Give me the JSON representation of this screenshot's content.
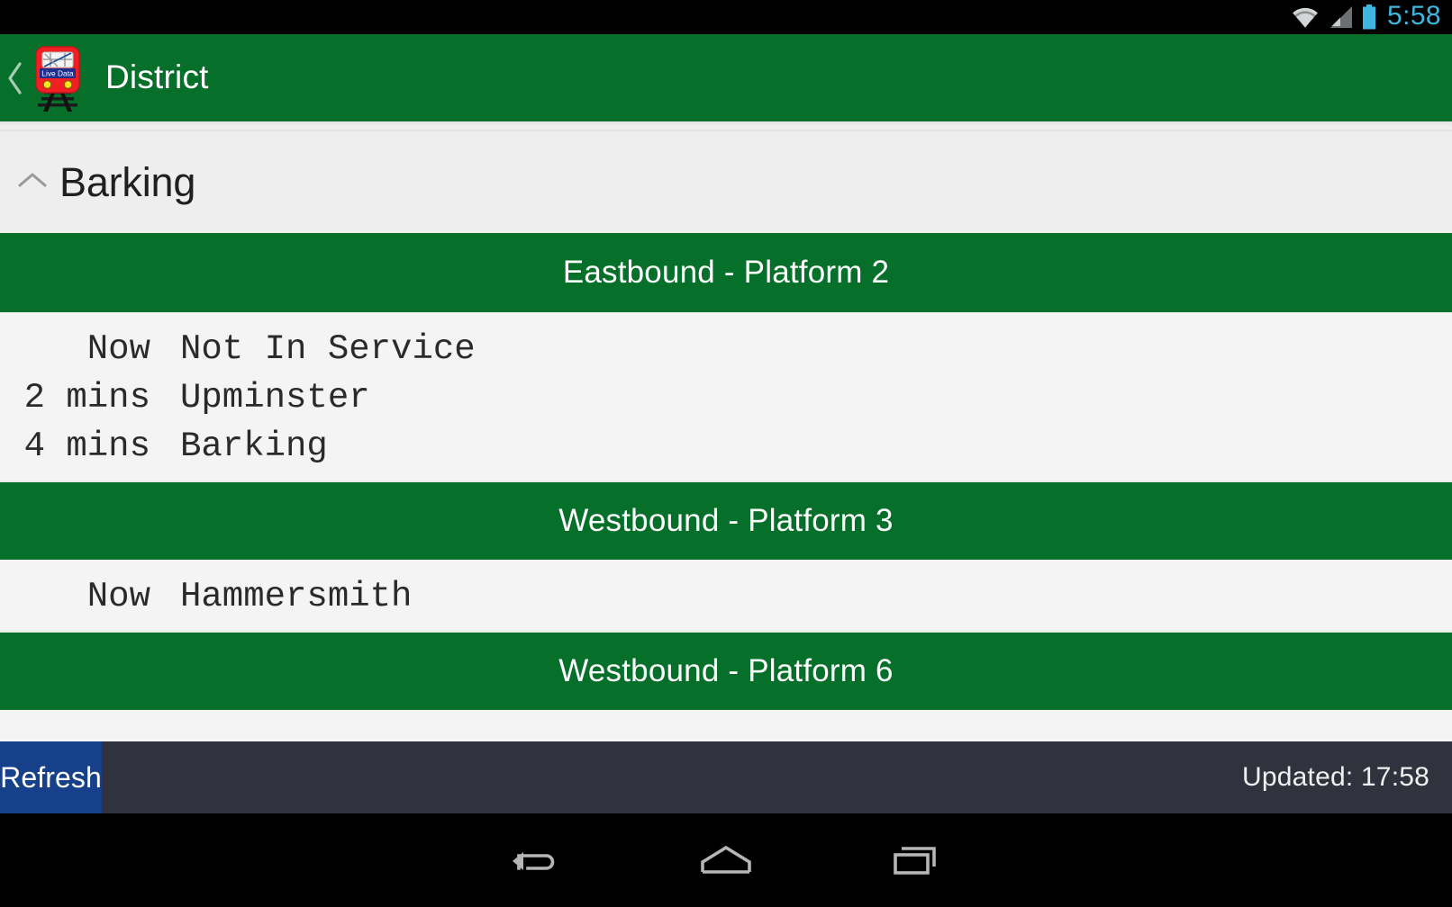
{
  "status_bar": {
    "time": "5:58",
    "icons": [
      "wifi-icon",
      "cellular-signal-icon",
      "battery-icon"
    ],
    "accent_color": "#3fb6e0"
  },
  "action_bar": {
    "back_label": "back-chevron",
    "app_icon_label": "Live Data",
    "title": "District",
    "background_color": "#06702a",
    "text_color": "#ffffff"
  },
  "station": {
    "name": "Barking",
    "expanded": true,
    "toggle_icon": "chevron-up-icon"
  },
  "sections": [
    {
      "heading": "Eastbound - Platform 2",
      "departures": [
        {
          "time": "Now",
          "destination": "Not In Service"
        },
        {
          "time": "2 mins",
          "destination": "Upminster"
        },
        {
          "time": "4 mins",
          "destination": "Barking"
        }
      ]
    },
    {
      "heading": "Westbound - Platform 3",
      "departures": [
        {
          "time": "Now",
          "destination": "Hammersmith"
        }
      ]
    },
    {
      "heading": "Westbound - Platform 6",
      "departures": []
    }
  ],
  "bottom_bar": {
    "refresh_label": "Refresh",
    "refresh_color": "#17408b",
    "updated_label": "Updated: 17:58",
    "background_color": "#30323d"
  },
  "nav_bar": {
    "back": "back-arrow-icon",
    "home": "home-icon",
    "recents": "recent-apps-icon"
  }
}
